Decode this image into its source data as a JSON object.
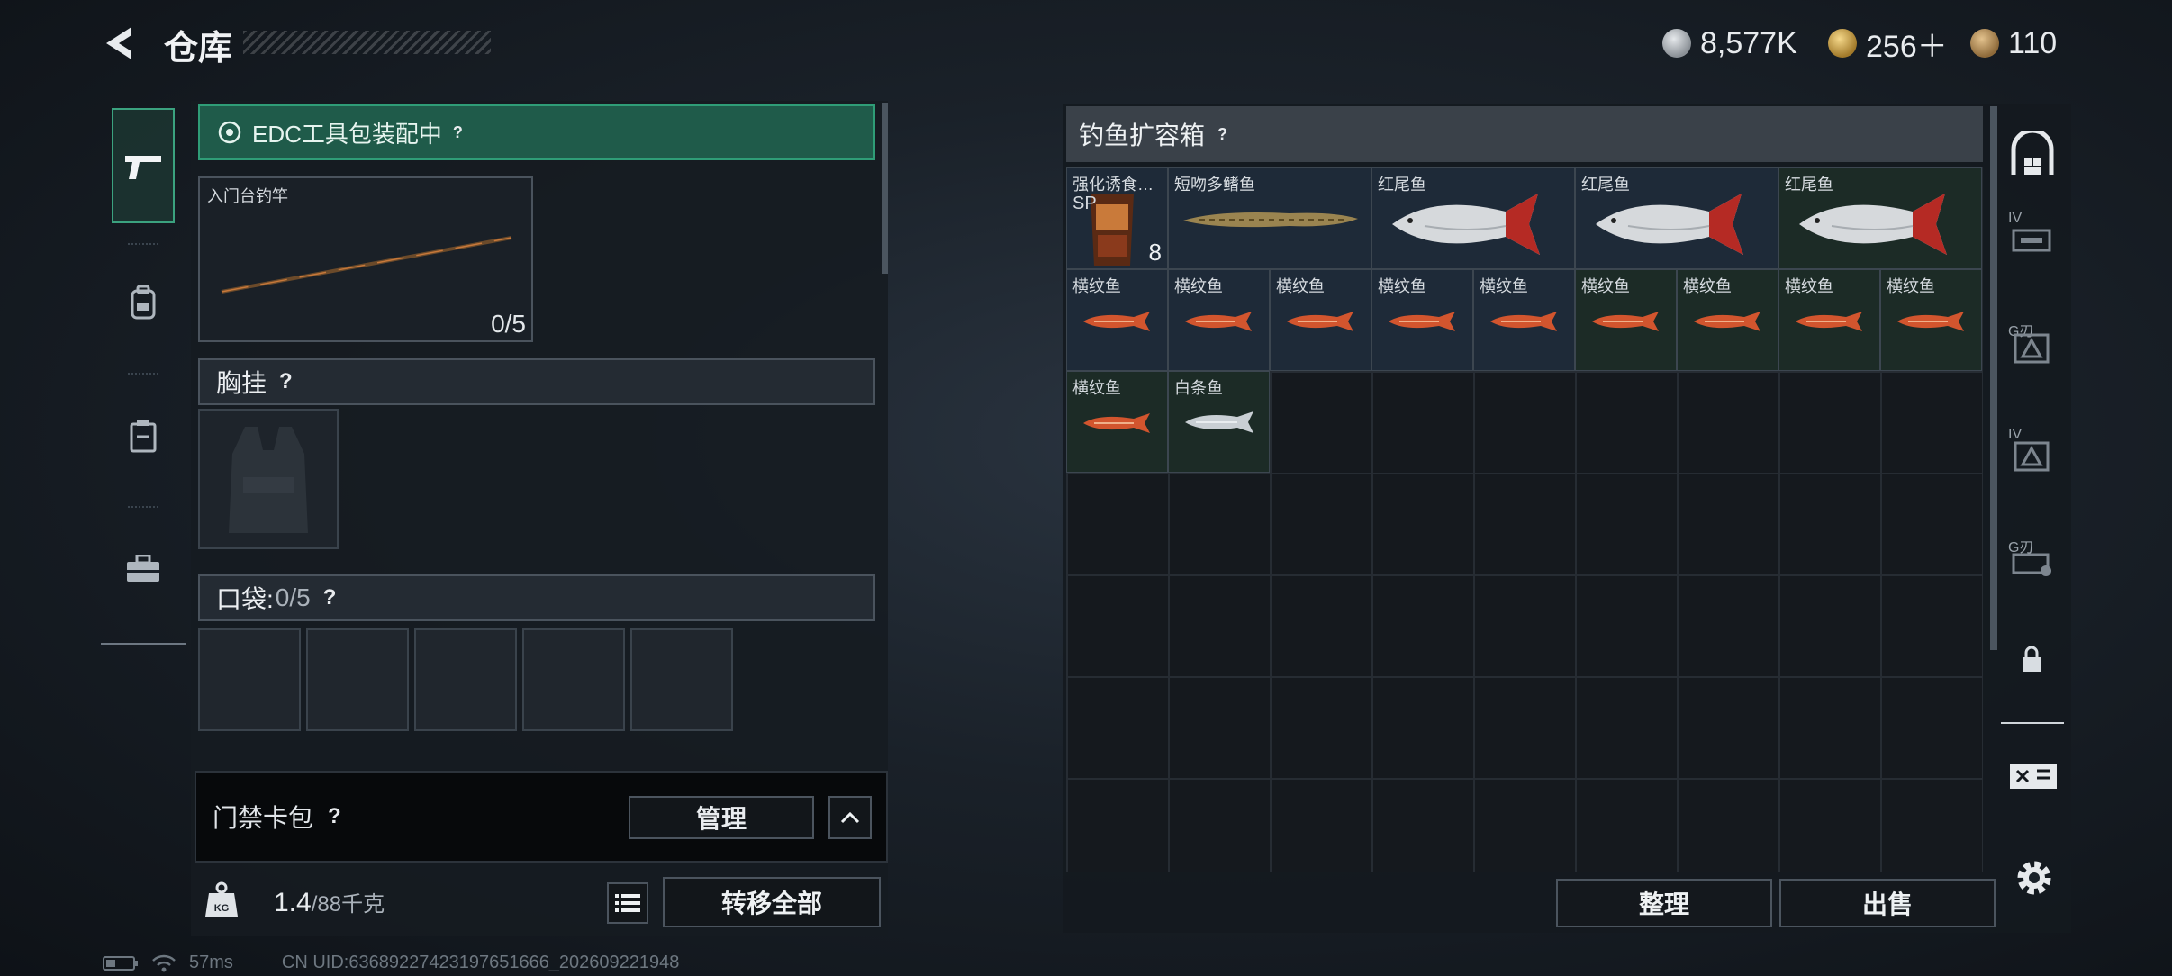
{
  "header": {
    "title": "仓库",
    "currencies": [
      {
        "icon": "silver-coin-icon",
        "value": "8,577K"
      },
      {
        "icon": "gold-triangle-coin-icon",
        "value": "256＋"
      },
      {
        "icon": "bronze-coin-icon",
        "value": "110"
      }
    ]
  },
  "left": {
    "edc_status": "EDC工具包装配中",
    "rod_label": "入门台钓竿",
    "rod_count": "0/5",
    "chest_title": "胸挂",
    "pocket_title": "口袋:",
    "pocket_count": "0/5",
    "card_pack_label": "门禁卡包",
    "manage_label": "管理",
    "weight_value": "1.4",
    "weight_max": "/88千克",
    "transfer_all_label": "转移全部"
  },
  "right": {
    "box_title": "钓鱼扩容箱",
    "items": [
      {
        "name": "强化诱食…",
        "extra": "SP",
        "count": "8",
        "type": "bait",
        "bg": "blue"
      },
      {
        "name": "短吻多鳍鱼",
        "type": "eel",
        "bg": "blue"
      },
      {
        "name": "红尾鱼",
        "type": "bigfish",
        "bg": "blue"
      },
      {
        "name": "红尾鱼",
        "type": "bigfish",
        "bg": "blue"
      },
      {
        "name": "红尾鱼",
        "type": "bigfish",
        "bg": "green"
      },
      {
        "name": "横纹鱼",
        "type": "smallred",
        "bg": "blue"
      },
      {
        "name": "横纹鱼",
        "type": "smallred",
        "bg": "blue"
      },
      {
        "name": "横纹鱼",
        "type": "smallred",
        "bg": "blue"
      },
      {
        "name": "横纹鱼",
        "type": "smallred",
        "bg": "blue"
      },
      {
        "name": "横纹鱼",
        "type": "smallred",
        "bg": "blue"
      },
      {
        "name": "横纹鱼",
        "type": "smallred",
        "bg": "green"
      },
      {
        "name": "横纹鱼",
        "type": "smallred",
        "bg": "green"
      },
      {
        "name": "横纹鱼",
        "type": "smallred",
        "bg": "green"
      },
      {
        "name": "横纹鱼",
        "type": "smallred",
        "bg": "green"
      },
      {
        "name": "横纹鱼",
        "type": "smallred",
        "bg": "green"
      },
      {
        "name": "白条鱼",
        "type": "white",
        "bg": "green"
      }
    ],
    "sort_label": "整理",
    "sell_label": "出售"
  },
  "sidebar_right": {
    "tiers": [
      "IV",
      "G刃",
      "IV",
      "G刃"
    ]
  },
  "footer": {
    "ping": "57ms",
    "uid": "CN UID:63689227423197651666_202609221948"
  }
}
